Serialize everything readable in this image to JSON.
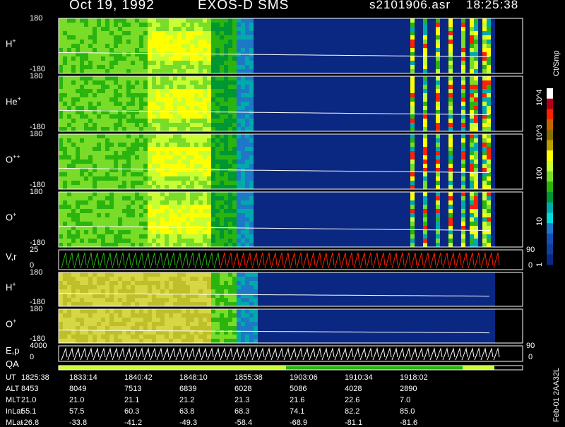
{
  "header": {
    "date": "Oct 19, 1992",
    "instrument": "EXOS-D SMS",
    "file": "s2101906.asr",
    "time": "18:25:38"
  },
  "colorbar": {
    "unit": "Ct/Smp",
    "labels": [
      "10^4",
      "10^3",
      "100",
      "10",
      "1"
    ],
    "colors": [
      "#ffffff",
      "#b0001a",
      "#ff2000",
      "#c86400",
      "#8c6e00",
      "#b8a000",
      "#ffff00",
      "#c8ff32",
      "#78dc28",
      "#2ab40f",
      "#009632",
      "#00aaaa",
      "#00dcdc",
      "#1e78c8",
      "#1450b4",
      "#143c9b",
      "#0a2882"
    ]
  },
  "footer_note": "Feb-01 2AA32L",
  "chart_data": {
    "type": "heatmap",
    "x_unit": "UT",
    "panels": [
      {
        "name": "H",
        "sup": "+",
        "ymax": "180",
        "ymin": "-180",
        "right_label": "",
        "right_zero": ""
      },
      {
        "name": "He",
        "sup": "+",
        "ymax": "180",
        "ymin": "-180",
        "right_label": "",
        "right_zero": ""
      },
      {
        "name": "O",
        "sup": "++",
        "ymax": "180",
        "ymin": "-180",
        "right_label": "",
        "right_zero": ""
      },
      {
        "name": "O",
        "sup": "+",
        "ymax": "180",
        "ymin": "-180",
        "right_label": "",
        "right_zero": ""
      },
      {
        "name": "V,r",
        "sup": "",
        "ymax": "25",
        "ymin": "0",
        "right_label": "90",
        "right_zero": "0"
      },
      {
        "name": "H",
        "sup": "+",
        "ymax": "180",
        "ymin": "-180",
        "right_label": "",
        "right_zero": ""
      },
      {
        "name": "O",
        "sup": "+",
        "ymax": "180",
        "ymin": "-180",
        "right_label": "",
        "right_zero": ""
      },
      {
        "name": "E,p",
        "sup": "",
        "ymax": "4000",
        "ymin": "0",
        "right_label": "90",
        "right_zero": "0"
      },
      {
        "name": "QA",
        "sup": "",
        "ymax": "",
        "ymin": "",
        "right_label": "",
        "right_zero": ""
      }
    ],
    "ephemeris": {
      "row_labels": [
        "UT",
        "ALT",
        "MLT",
        "InLat",
        "MLat"
      ],
      "columns": [
        [
          "1825:38",
          "8453",
          "21.0",
          "55.1",
          "-26.8"
        ],
        [
          "1833:14",
          "8049",
          "21.0",
          "57.5",
          "-33.8"
        ],
        [
          "1840:42",
          "7513",
          "21.1",
          "60.3",
          "-41.2"
        ],
        [
          "1848:10",
          "6839",
          "21.2",
          "63.8",
          "-49.3"
        ],
        [
          "1855:38",
          "6028",
          "21.3",
          "68.3",
          "-58.4"
        ],
        [
          "1903:06",
          "5086",
          "21.6",
          "74.1",
          "-68.9"
        ],
        [
          "1910:34",
          "4028",
          "22.6",
          "82.2",
          "-81.1"
        ],
        [
          "1918:02",
          "2890",
          "7.0",
          "85.0",
          "-81.6"
        ]
      ]
    }
  }
}
